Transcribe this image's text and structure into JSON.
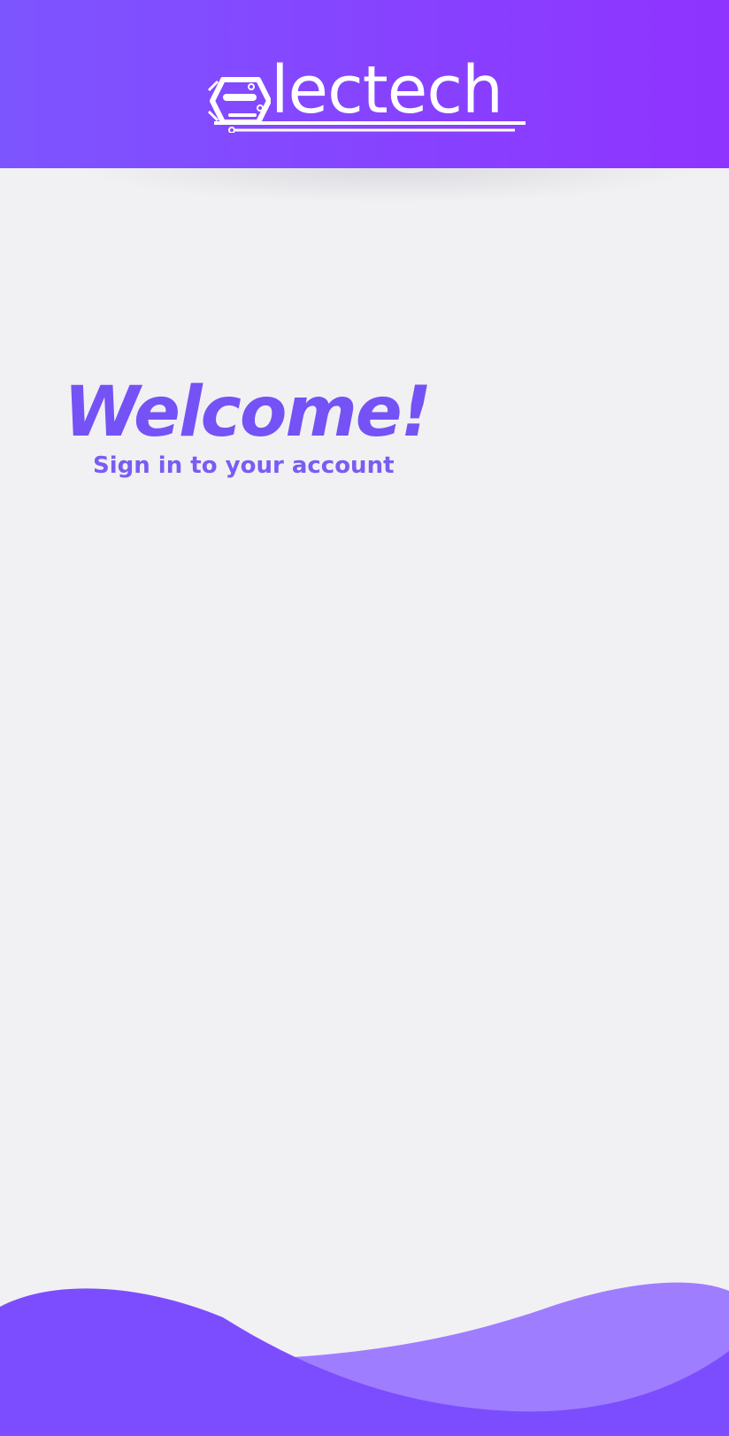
{
  "brand": {
    "name": "lectech",
    "logo_icon": "circuit-e-icon",
    "gradient_start": "#7d55ff",
    "gradient_end": "#8f33ff"
  },
  "welcome": {
    "title": "Welcome!",
    "subtitle": "Sign in to your account"
  },
  "colors": {
    "accent": "#7552f5",
    "background": "#f1f1f3",
    "wave_light": "#9f7dff",
    "wave_dark": "#7c4dff"
  }
}
